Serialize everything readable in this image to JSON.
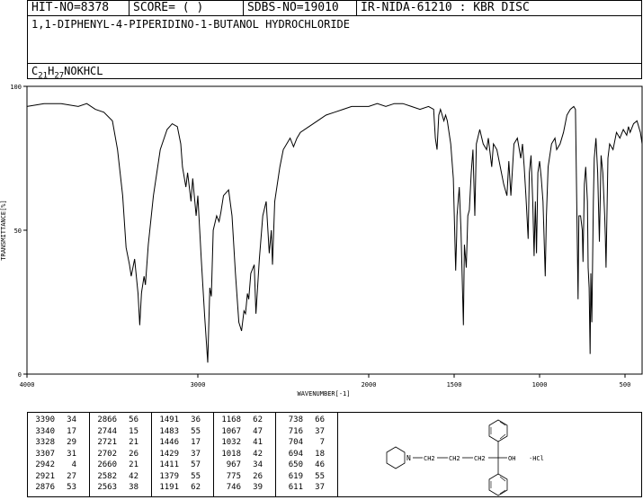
{
  "header": {
    "hit_no": "HIT-NO=8378",
    "score": "SCORE=  (   )",
    "sdbs_no": "SDBS-NO=19010",
    "ir_id": "IR-NIDA-61210 : KBR DISC",
    "compound": "1,1-DIPHENYL-4-PIPERIDINO-1-BUTANOL HYDROCHLORIDE",
    "formula": {
      "c": "C",
      "c_n": "21",
      "h": "H",
      "h_n": "27",
      "rest": "NOKHCL"
    }
  },
  "structure": {
    "n_label": "N",
    "ch2_labels": [
      "CH2",
      "CH2",
      "CH2"
    ],
    "oh_label": "OH",
    "salt_label": "·HCl"
  },
  "chart_data": {
    "type": "line",
    "xlabel": "WAVENUMBER[-1]",
    "ylabel": "TRANSMITTANCE[%]",
    "xlim": [
      4000,
      400
    ],
    "ylim": [
      0,
      100
    ],
    "x_ticks": [
      4000,
      3000,
      2000,
      1500,
      1000,
      500
    ],
    "y_ticks": [
      100,
      50,
      0
    ],
    "series": [
      {
        "points": [
          [
            4000,
            93
          ],
          [
            3900,
            94
          ],
          [
            3800,
            94
          ],
          [
            3700,
            93
          ],
          [
            3650,
            94
          ],
          [
            3600,
            92
          ],
          [
            3550,
            91
          ],
          [
            3500,
            88
          ],
          [
            3470,
            78
          ],
          [
            3440,
            62
          ],
          [
            3420,
            44
          ],
          [
            3400,
            38
          ],
          [
            3390,
            34
          ],
          [
            3370,
            40
          ],
          [
            3350,
            28
          ],
          [
            3340,
            17
          ],
          [
            3330,
            28
          ],
          [
            3328,
            29
          ],
          [
            3315,
            34
          ],
          [
            3307,
            31
          ],
          [
            3290,
            45
          ],
          [
            3260,
            62
          ],
          [
            3220,
            78
          ],
          [
            3180,
            85
          ],
          [
            3150,
            87
          ],
          [
            3120,
            86
          ],
          [
            3100,
            80
          ],
          [
            3090,
            72
          ],
          [
            3070,
            65
          ],
          [
            3060,
            70
          ],
          [
            3040,
            60
          ],
          [
            3030,
            68
          ],
          [
            3010,
            55
          ],
          [
            3000,
            62
          ],
          [
            2980,
            40
          ],
          [
            2960,
            20
          ],
          [
            2942,
            4
          ],
          [
            2930,
            30
          ],
          [
            2921,
            27
          ],
          [
            2910,
            50
          ],
          [
            2890,
            55
          ],
          [
            2876,
            53
          ],
          [
            2866,
            56
          ],
          [
            2850,
            62
          ],
          [
            2820,
            64
          ],
          [
            2800,
            55
          ],
          [
            2780,
            35
          ],
          [
            2760,
            18
          ],
          [
            2744,
            15
          ],
          [
            2730,
            22
          ],
          [
            2721,
            21
          ],
          [
            2710,
            28
          ],
          [
            2702,
            26
          ],
          [
            2690,
            35
          ],
          [
            2670,
            38
          ],
          [
            2660,
            21
          ],
          [
            2640,
            40
          ],
          [
            2620,
            55
          ],
          [
            2600,
            60
          ],
          [
            2582,
            42
          ],
          [
            2570,
            50
          ],
          [
            2563,
            38
          ],
          [
            2550,
            60
          ],
          [
            2520,
            72
          ],
          [
            2500,
            78
          ],
          [
            2480,
            80
          ],
          [
            2460,
            82
          ],
          [
            2440,
            79
          ],
          [
            2420,
            82
          ],
          [
            2400,
            84
          ],
          [
            2350,
            86
          ],
          [
            2300,
            88
          ],
          [
            2250,
            90
          ],
          [
            2200,
            91
          ],
          [
            2150,
            92
          ],
          [
            2100,
            93
          ],
          [
            2050,
            93
          ],
          [
            2000,
            93
          ],
          [
            1950,
            94
          ],
          [
            1900,
            93
          ],
          [
            1850,
            94
          ],
          [
            1800,
            94
          ],
          [
            1750,
            93
          ],
          [
            1700,
            92
          ],
          [
            1650,
            93
          ],
          [
            1620,
            92
          ],
          [
            1610,
            82
          ],
          [
            1600,
            78
          ],
          [
            1590,
            90
          ],
          [
            1580,
            92
          ],
          [
            1570,
            90
          ],
          [
            1560,
            88
          ],
          [
            1550,
            90
          ],
          [
            1540,
            88
          ],
          [
            1520,
            80
          ],
          [
            1505,
            68
          ],
          [
            1491,
            36
          ],
          [
            1485,
            48
          ],
          [
            1483,
            55
          ],
          [
            1470,
            65
          ],
          [
            1460,
            50
          ],
          [
            1446,
            17
          ],
          [
            1440,
            45
          ],
          [
            1429,
            37
          ],
          [
            1420,
            55
          ],
          [
            1411,
            57
          ],
          [
            1400,
            70
          ],
          [
            1390,
            78
          ],
          [
            1379,
            55
          ],
          [
            1370,
            80
          ],
          [
            1350,
            85
          ],
          [
            1330,
            80
          ],
          [
            1310,
            78
          ],
          [
            1300,
            82
          ],
          [
            1280,
            72
          ],
          [
            1270,
            80
          ],
          [
            1250,
            78
          ],
          [
            1230,
            72
          ],
          [
            1210,
            66
          ],
          [
            1191,
            62
          ],
          [
            1180,
            74
          ],
          [
            1168,
            62
          ],
          [
            1150,
            80
          ],
          [
            1130,
            82
          ],
          [
            1110,
            75
          ],
          [
            1100,
            80
          ],
          [
            1090,
            72
          ],
          [
            1080,
            62
          ],
          [
            1067,
            47
          ],
          [
            1060,
            70
          ],
          [
            1050,
            76
          ],
          [
            1040,
            60
          ],
          [
            1032,
            41
          ],
          [
            1025,
            60
          ],
          [
            1018,
            42
          ],
          [
            1010,
            70
          ],
          [
            1000,
            74
          ],
          [
            990,
            68
          ],
          [
            980,
            60
          ],
          [
            967,
            34
          ],
          [
            960,
            55
          ],
          [
            950,
            72
          ],
          [
            930,
            80
          ],
          [
            910,
            82
          ],
          [
            900,
            78
          ],
          [
            880,
            80
          ],
          [
            860,
            84
          ],
          [
            840,
            90
          ],
          [
            820,
            92
          ],
          [
            800,
            93
          ],
          [
            790,
            92
          ],
          [
            775,
            26
          ],
          [
            770,
            55
          ],
          [
            760,
            55
          ],
          [
            750,
            50
          ],
          [
            746,
            39
          ],
          [
            738,
            66
          ],
          [
            730,
            72
          ],
          [
            720,
            60
          ],
          [
            716,
            37
          ],
          [
            710,
            30
          ],
          [
            704,
            7
          ],
          [
            700,
            35
          ],
          [
            694,
            18
          ],
          [
            685,
            60
          ],
          [
            680,
            75
          ],
          [
            670,
            82
          ],
          [
            660,
            70
          ],
          [
            650,
            46
          ],
          [
            640,
            76
          ],
          [
            630,
            70
          ],
          [
            619,
            55
          ],
          [
            615,
            48
          ],
          [
            611,
            37
          ],
          [
            600,
            75
          ],
          [
            590,
            80
          ],
          [
            570,
            78
          ],
          [
            550,
            84
          ],
          [
            530,
            82
          ],
          [
            510,
            85
          ],
          [
            490,
            83
          ],
          [
            480,
            86
          ],
          [
            470,
            84
          ],
          [
            450,
            87
          ],
          [
            430,
            88
          ],
          [
            410,
            84
          ],
          [
            400,
            80
          ]
        ]
      }
    ]
  },
  "peak_table": {
    "columns": [
      [
        [
          3390,
          34
        ],
        [
          3340,
          17
        ],
        [
          3328,
          29
        ],
        [
          3307,
          31
        ],
        [
          2942,
          4
        ],
        [
          2921,
          27
        ],
        [
          2876,
          53
        ]
      ],
      [
        [
          2866,
          56
        ],
        [
          2744,
          15
        ],
        [
          2721,
          21
        ],
        [
          2702,
          26
        ],
        [
          2660,
          21
        ],
        [
          2582,
          42
        ],
        [
          2563,
          38
        ]
      ],
      [
        [
          1491,
          36
        ],
        [
          1483,
          55
        ],
        [
          1446,
          17
        ],
        [
          1429,
          37
        ],
        [
          1411,
          57
        ],
        [
          1379,
          55
        ],
        [
          1191,
          62
        ]
      ],
      [
        [
          1168,
          62
        ],
        [
          1067,
          47
        ],
        [
          1032,
          41
        ],
        [
          1018,
          42
        ],
        [
          967,
          34
        ],
        [
          775,
          26
        ],
        [
          746,
          39
        ]
      ],
      [
        [
          738,
          66
        ],
        [
          716,
          37
        ],
        [
          704,
          7
        ],
        [
          694,
          18
        ],
        [
          650,
          46
        ],
        [
          619,
          55
        ],
        [
          611,
          37
        ]
      ]
    ]
  }
}
